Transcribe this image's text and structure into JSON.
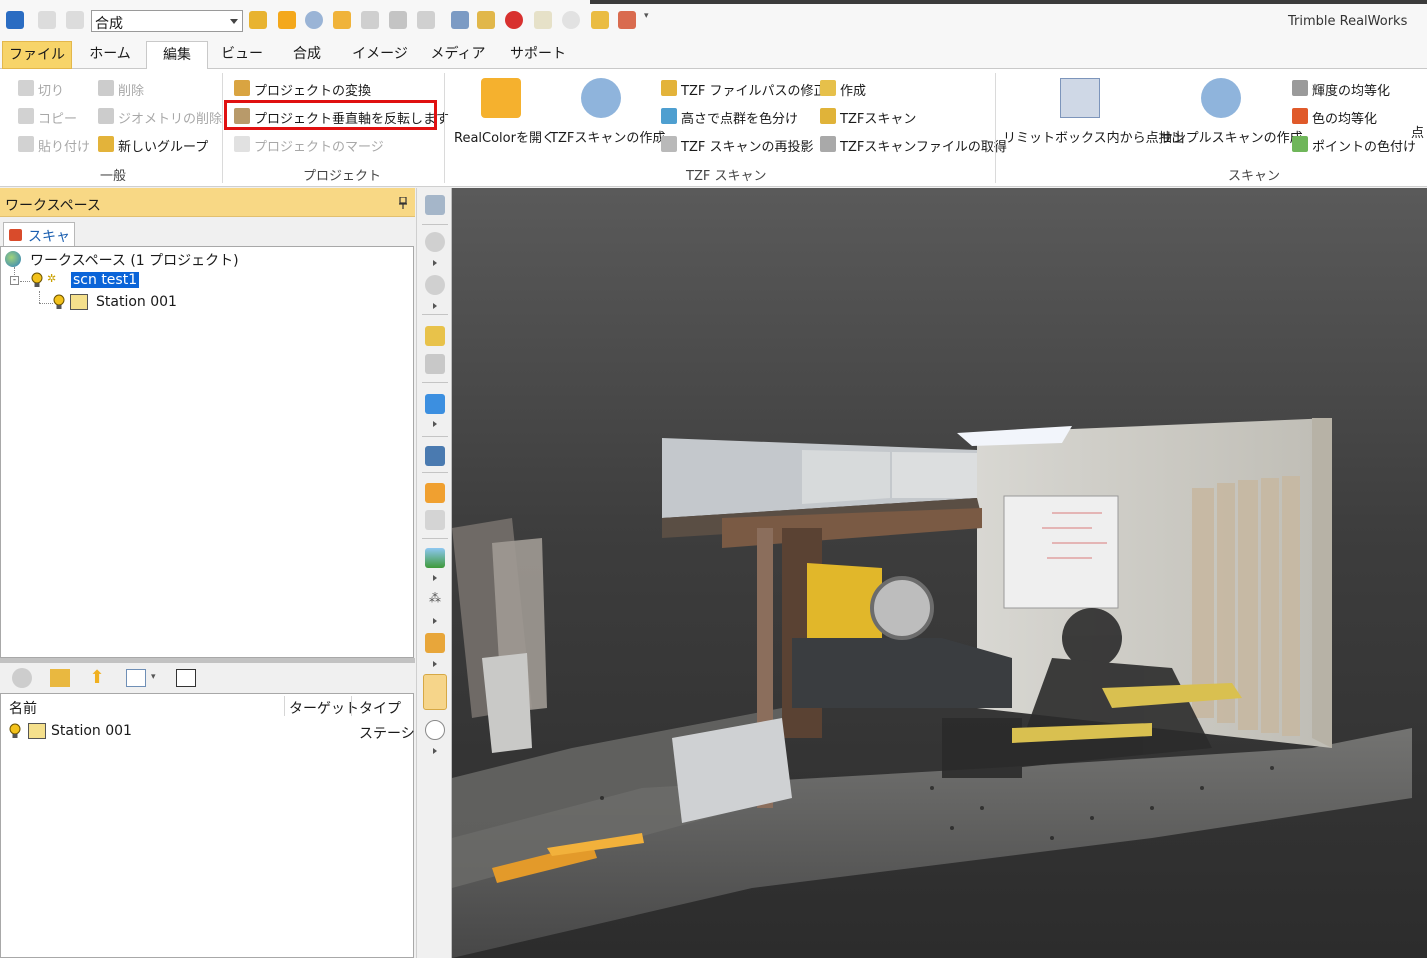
{
  "app_title": "Trimble RealWorks",
  "quick_access": {
    "mode_combo_value": "合成",
    "icons": [
      "home-icon",
      "undo-icon",
      "redo-icon",
      "open-project-icon",
      "search-icon",
      "globe-icon",
      "camera-icon",
      "save-icon",
      "save-as-icon",
      "document-icon",
      "ruler-icon",
      "pen-icon",
      "magnet-icon",
      "pencil-icon",
      "eraser-icon",
      "folder-icon",
      "window-icon",
      "dropdown-icon"
    ]
  },
  "menu_tabs": [
    "ファイル",
    "ホーム",
    "編集",
    "ビュー",
    "合成",
    "イメージ",
    "メディア",
    "サポート"
  ],
  "active_tab": "編集",
  "ribbon": {
    "general": {
      "label": "一般",
      "cut": "切り",
      "copy": "コピー",
      "paste": "貼り付け",
      "delete": "削除",
      "delete_geometry": "ジオメトリの削除",
      "new_group": "新しいグループ"
    },
    "project": {
      "label": "プロジェクト",
      "convert": "プロジェクトの変換",
      "flip_vertical": "プロジェクト垂直軸を反転します",
      "merge": "プロジェクトのマージ"
    },
    "tzf": {
      "label": "TZF スキャン",
      "open_realcolor": "RealColorを開く",
      "create_tzf": "TZFスキャンの作成",
      "fix_path": "TZF ファイルパスの修正",
      "color_by_height": "高さで点群を色分け",
      "reproject": "TZF スキャンの再投影",
      "create": "作成",
      "tzf_scan": "TZFスキャン",
      "get_file": "TZFスキャンファイルの取得"
    },
    "scan": {
      "label": "スキャン",
      "extract_limit": "リミットボックス内から点抽出",
      "create_sample": "サンプルスキャンの作成",
      "equalize_intensity": "輝度の均等化",
      "equalize_color": "色の均等化",
      "color_points": "ポイントの色付け",
      "overflow": "点"
    }
  },
  "workspace": {
    "title": "ワークスペース",
    "tab": "スキャン",
    "root": "ワークスペース (1 プロジェクト)",
    "project": "scn test1",
    "station": "Station 001"
  },
  "list": {
    "columns": [
      "名前",
      "ターゲット",
      "タイプ"
    ],
    "rows": [
      {
        "name": "Station 001",
        "target": "",
        "type": "ステーショ"
      }
    ]
  }
}
